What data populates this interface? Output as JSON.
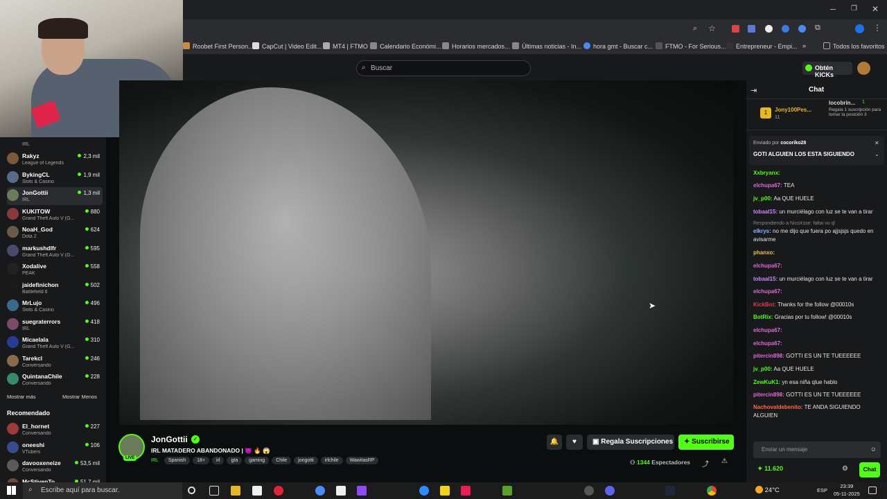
{
  "browser": {
    "bookmarks": [
      "Roobet First Person...",
      "CapCut | Video Edit...",
      "MT4 | FTMO",
      "Calendario Económi...",
      "Horarios mercados...",
      "Últimas noticias - In...",
      "hora gmt - Buscar c...",
      "FTMO - For Serious...",
      "Entrepreneur - Empi..."
    ],
    "all_favorites": "Todos los favoritos"
  },
  "header": {
    "search_placeholder": "Buscar",
    "get_kicks": "Obtén KICKs"
  },
  "sidebar": {
    "top_game": "IRL",
    "channels": [
      {
        "name": "Rakyz",
        "game": "League of Legends",
        "viewers": "2,3 mil",
        "color": "#7a5a3a"
      },
      {
        "name": "BykingCL",
        "game": "Slots & Casino",
        "viewers": "1,9 mil",
        "color": "#5a6a8a"
      },
      {
        "name": "JonGottii",
        "game": "IRL",
        "viewers": "1,3 mil",
        "color": "#6a7a5a"
      },
      {
        "name": "KUKITOW",
        "game": "Grand Theft Auto V (G...",
        "viewers": "880",
        "color": "#8a3a3a"
      },
      {
        "name": "NoaH_God",
        "game": "Dota 2",
        "viewers": "624",
        "color": "#6a5a4a"
      },
      {
        "name": "markushdlfr",
        "game": "Grand Theft Auto V (G...",
        "viewers": "595",
        "color": "#4a4a6a"
      },
      {
        "name": "Xodalive",
        "game": "PEAK",
        "viewers": "558",
        "color": "#222222"
      },
      {
        "name": "jaidefinichon",
        "game": "Battlefield 6",
        "viewers": "502",
        "color": "#1a1a1a"
      },
      {
        "name": "MrLujo",
        "game": "Slots & Casino",
        "viewers": "496",
        "color": "#3a6a8a"
      },
      {
        "name": "suegraterrors",
        "game": "IRL",
        "viewers": "418",
        "color": "#7a4a6a"
      },
      {
        "name": "Micaelala",
        "game": "Grand Theft Auto V (G...",
        "viewers": "310",
        "color": "#2a3a9a"
      },
      {
        "name": "Tarekcl",
        "game": "Conversando",
        "viewers": "246",
        "color": "#8a6a4a"
      },
      {
        "name": "QuintanaChile",
        "game": "Conversando",
        "viewers": "228",
        "color": "#3a8a6a"
      }
    ],
    "show_more": "Mostrar más",
    "show_less": "Mostrar Menos",
    "recommended_title": "Recomendado",
    "recommended": [
      {
        "name": "El_hornet",
        "game": "Conversando",
        "viewers": "227",
        "color": "#a03a3a"
      },
      {
        "name": "oneeshi",
        "game": "VTubers",
        "viewers": "106",
        "color": "#3a4a8a"
      },
      {
        "name": "davooxeneize",
        "game": "Conversando",
        "viewers": "53,5 mil",
        "color": "#5a5a5a"
      },
      {
        "name": "McStivenTo",
        "game": "",
        "viewers": "51,7 mil",
        "color": "#6a4a3a"
      }
    ]
  },
  "stream": {
    "streamer": "JonGottii",
    "live_badge": "LIVE",
    "title": "IRL MATADERO ABANDONADO | 👿 🔥 😱",
    "category": "IRL",
    "tags": [
      "Spanish",
      "18+",
      "irl",
      "gta",
      "gaming",
      "Chile",
      "jongotti",
      "irlchile",
      "WawitasRP"
    ],
    "gift_subs": "Regala Suscripciones",
    "subscribe": "Suscribirse",
    "viewers_count": "1344",
    "viewers_label": "Espectadores"
  },
  "chat": {
    "title": "Chat",
    "gifter1_name": "Jony100Pes...",
    "gifter1_count": "11",
    "gifter2_name": "locobrin...",
    "gifter2_count": "1",
    "gifter2_note": "Regala 1 suscripción para tomar la posición 3",
    "pinned_by_label": "Enviado por",
    "pinned_by": "cocoriko28",
    "pinned_text": "GOTI ALGUIEN LOS ESTA SIGUIENDO",
    "reply_note": "Respondiendo a NicoXsse: faltai vo ql",
    "messages": [
      {
        "user": "Xxbryanx:",
        "text": "",
        "color": "#53fc18"
      },
      {
        "user": "elchupa67:",
        "text": "TEA",
        "color": "#e06ad5"
      },
      {
        "user": "jv_p00:",
        "text": "Aa QUE HUELE",
        "color": "#53fc18"
      },
      {
        "user": "tobaal15:",
        "text": "un murciélago con luz se te van a tirar",
        "color": "#c88cff"
      },
      {
        "user": "elkrys:",
        "text": "no me dijo que fuera po ajjsjsjs quedo en avisarme",
        "color": "#8ab4ff"
      },
      {
        "user": "phanxo:",
        "text": "",
        "color": "#e8c34a"
      },
      {
        "user": "elchupa67:",
        "text": "",
        "color": "#e06ad5"
      },
      {
        "user": "tobaal15:",
        "text": "un murciélago con luz se te van a tirar",
        "color": "#c88cff"
      },
      {
        "user": "elchupa67:",
        "text": "",
        "color": "#e06ad5"
      },
      {
        "user": "KickBot:",
        "text": "Thanks for the follow @00010s",
        "color": "#e8394a"
      },
      {
        "user": "BotRix:",
        "text": "Gracias por tu follow! @00010s",
        "color": "#53fc18"
      },
      {
        "user": "elchupa67:",
        "text": "",
        "color": "#e06ad5"
      },
      {
        "user": "elchupa67:",
        "text": "",
        "color": "#e06ad5"
      },
      {
        "user": "pitercin898:",
        "text": "GOTTI ES UN TE TUEEEEEE",
        "color": "#e06ad5"
      },
      {
        "user": "jv_p00:",
        "text": "Aa QUE HUELE",
        "color": "#53fc18"
      },
      {
        "user": "ZewKuK1:",
        "text": "yn esa niña qlue hablo",
        "color": "#53fc18"
      },
      {
        "user": "pitercin898:",
        "text": "GOTTI ES UN TE TUEEEEEE",
        "color": "#e06ad5"
      },
      {
        "user": "Nachovaldebenito:",
        "text": "TE ANDA SIGUIENDO ALGUIEN",
        "color": "#ff6a4a"
      }
    ],
    "input_placeholder": "Enviar un mensaje",
    "points": "11.620",
    "send_button": "Chat"
  },
  "taskbar": {
    "search_placeholder": "Escribe aquí para buscar.",
    "weather": "24°C",
    "language": "ESP",
    "time": "23:39",
    "date": "05-11-2025"
  },
  "colors": {
    "accent": "#53fc18",
    "bg": "#0b0e0f",
    "panel": "#18191b"
  }
}
